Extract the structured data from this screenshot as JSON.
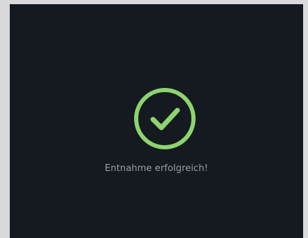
{
  "dialog": {
    "icon": "check-circle-icon",
    "message": "Entnahme erfolgreich!"
  },
  "colors": {
    "background": "#141a20",
    "accent": "#8ed36f",
    "text": "#9aa0a6",
    "frame": "#d9dadb"
  }
}
